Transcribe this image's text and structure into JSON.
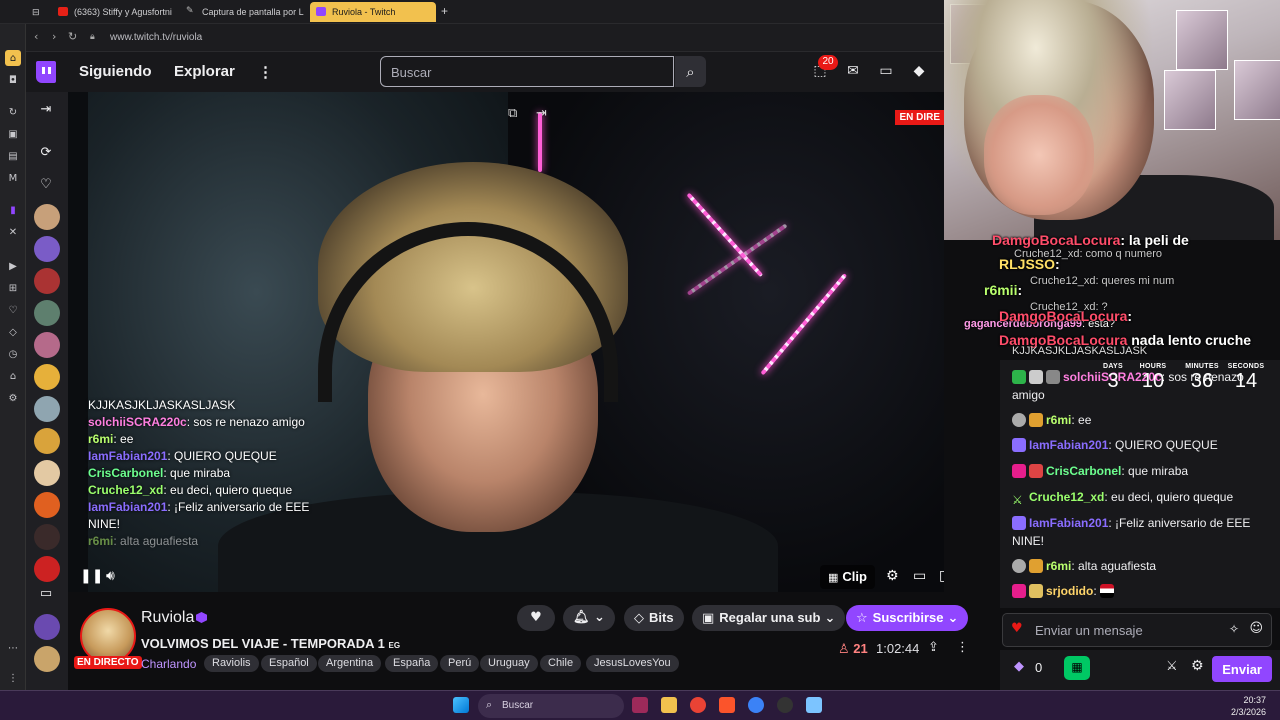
{
  "browser": {
    "tabs": [
      {
        "label": "(6363) Stiffy y Agusfortni",
        "active": false
      },
      {
        "label": "Captura de pantalla por Li",
        "active": false
      },
      {
        "label": "Ruviola - Twitch",
        "active": true
      }
    ],
    "new_tab": "+",
    "url": "www.twitch.tv/ruviola"
  },
  "twitch_nav": {
    "following": "Siguiendo",
    "browse": "Explorar",
    "more": "⋮",
    "search_placeholder": "Buscar",
    "notifications_count": "20"
  },
  "video": {
    "live_label": "EN DIRE",
    "clip_label": "Clip",
    "overlay_chat": [
      {
        "user": "",
        "text": "KJJKASJKLJASKASLJASK",
        "color": "#ffffff"
      },
      {
        "user": "solchiiSCRA220c",
        "text": ": sos re nenazo amigo",
        "color": "#ff7fe0"
      },
      {
        "user": "r6mi",
        "text": ": ee",
        "color": "#b9ff6e"
      },
      {
        "user": "IamFabian201",
        "text": ": QUIERO QUEQUE",
        "color": "#8a6dff"
      },
      {
        "user": "CrisCarbonel",
        "text": ": que miraba",
        "color": "#6dff8f"
      },
      {
        "user": "Cruche12_xd",
        "text": ": eu deci, quiero queque",
        "color": "#9bff6d"
      },
      {
        "user": "IamFabian201",
        "text": ": ¡Feliz aniversario de EEE NINE!",
        "color": "#8a6dff"
      },
      {
        "user": "r6mi",
        "text": ": alta aguafiesta",
        "color": "#b9ff6e"
      }
    ]
  },
  "channel": {
    "name": "Ruviola",
    "live_badge": "EN DIRECTO",
    "title": "VOLVIMOS DEL VIAJE - TEMPORADA 1",
    "title_suffix": "EG",
    "category": "Charlando",
    "tags": [
      "Raviolis",
      "Español",
      "Argentina",
      "España",
      "Perú",
      "Uruguay",
      "Chile",
      "JesusLovesYou"
    ],
    "viewers": "21",
    "uptime": "1:02:44",
    "bits_label": "Bits",
    "gift_label": "Regalar una sub",
    "subscribe_label": "Suscribirse"
  },
  "overlay": {
    "lines": [
      {
        "user": "DamgoBocaLocura",
        "text": ": la peli de",
        "color": "#ff4d6a"
      },
      {
        "user": "RLJSSO",
        "text": ":",
        "color": "#ffe066"
      },
      {
        "user": "r6mii",
        "text": ":",
        "color": "#b9ff6e"
      },
      {
        "user": "DamgoBocaLocura",
        "text": ":",
        "color": "#ff4d6a"
      },
      {
        "user": "DamgoBocaLocura",
        "text": "nada lento cruche",
        "color": "#ff4d6a"
      }
    ],
    "small": [
      {
        "user": "Cruche12_xd",
        "text": ": como q numero"
      },
      {
        "user": "Cruche12_xd",
        "text": ": queres mi num"
      },
      {
        "user": "Cruche12_xd",
        "text": ": ?"
      },
      {
        "user": "gagancerdeboronga99",
        "text": ": esta?"
      }
    ],
    "shout": "KJJKASJKLJASKASLJASK",
    "countdown": {
      "days_label": "DAYS",
      "days": "3",
      "hours_label": "HOURS",
      "hours": "10",
      "minutes_label": "MINUTES",
      "minutes": "36",
      "seconds_label": "SECONDS",
      "seconds": "14"
    }
  },
  "chat": {
    "messages": [
      {
        "user": "solchiiSCRA220c",
        "text": ": sos re nenazo amigo",
        "color": "#ff7fe0"
      },
      {
        "user": "r6mi",
        "text": ": ee",
        "color": "#b9ff6e"
      },
      {
        "user": "IamFabian201",
        "text": ": QUIERO QUEQUE",
        "color": "#8a6dff"
      },
      {
        "user": "CrisCarbonel",
        "text": ": que miraba",
        "color": "#6dff8f"
      },
      {
        "user": "Cruche12_xd",
        "text": ": eu deci, quiero queque",
        "color": "#9bff6d"
      },
      {
        "user": "IamFabian201",
        "text": ": ¡Feliz aniversario de EEE NINE!",
        "color": "#8a6dff"
      },
      {
        "user": "r6mi",
        "text": ": alta aguafiesta",
        "color": "#b9ff6e"
      },
      {
        "user": "srjodido",
        "text": ":",
        "color": "#ffd56a"
      }
    ],
    "input_placeholder": "Enviar un mensaje",
    "points": "0",
    "send_label": "Enviar"
  },
  "taskbar": {
    "search_placeholder": "Buscar",
    "time": "20:37",
    "date": "2/3/2026"
  }
}
